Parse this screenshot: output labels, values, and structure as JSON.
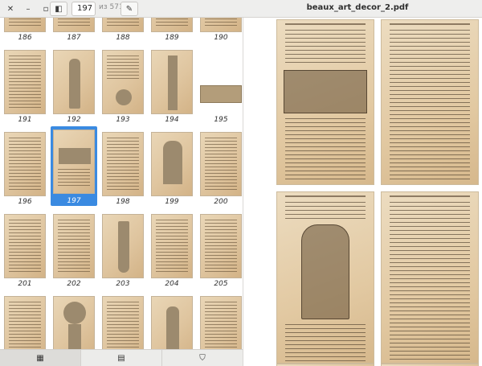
{
  "header": {
    "close_icon": "close-icon",
    "minimize_icon": "minimize-icon",
    "maximize_icon": "maximize-icon",
    "sidebar_toggle_icon": "sidebar-toggle-icon",
    "page_number": "197",
    "page_total": "из 571",
    "annotate_icon": "pencil-icon",
    "title": "beaux_art_decor_2.pdf"
  },
  "sidebar": {
    "rows": [
      {
        "labels": [
          "186",
          "187",
          "188",
          "189",
          "190"
        ]
      },
      {
        "labels": [
          "191",
          "192",
          "193",
          "194",
          "195"
        ]
      },
      {
        "labels": [
          "196",
          "197",
          "198",
          "199",
          "200"
        ]
      },
      {
        "labels": [
          "201",
          "202",
          "203",
          "204",
          "205"
        ]
      },
      {
        "labels": [
          "",
          "",
          "",
          "",
          ""
        ]
      }
    ],
    "selected_page": "197",
    "tabs": [
      {
        "icon": "thumbnails-icon",
        "label": "▦"
      },
      {
        "icon": "annotations-icon",
        "label": "▤"
      },
      {
        "icon": "bookmark-icon",
        "label": "⛉"
      }
    ]
  },
  "colors": {
    "selection": "#3a8ae1",
    "paper": "#e2c9a2",
    "header": "#eeeeed"
  }
}
